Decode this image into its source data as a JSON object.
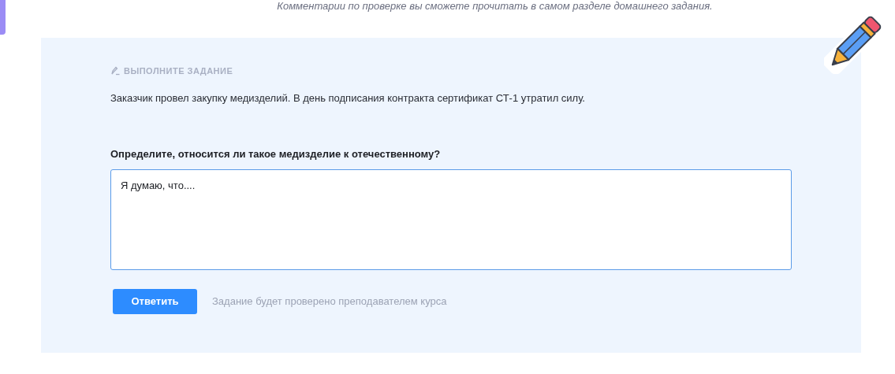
{
  "notice": "Комментарии по проверке вы сможете прочитать в самом разделе домашнего задания.",
  "task": {
    "heading": "ВЫПОЛНИТЕ ЗАДАНИЕ",
    "description": "Заказчик провел закупку медизделий. В день подписания контракта сертификат СТ-1 утратил силу.",
    "question": "Определите, относится ли такое медизделие к отечественному?",
    "answer": {
      "value": "Я думаю, что....",
      "focused": true
    },
    "submit_button": "Ответить",
    "note": "Задание будет проверено преподавателем курса"
  }
}
